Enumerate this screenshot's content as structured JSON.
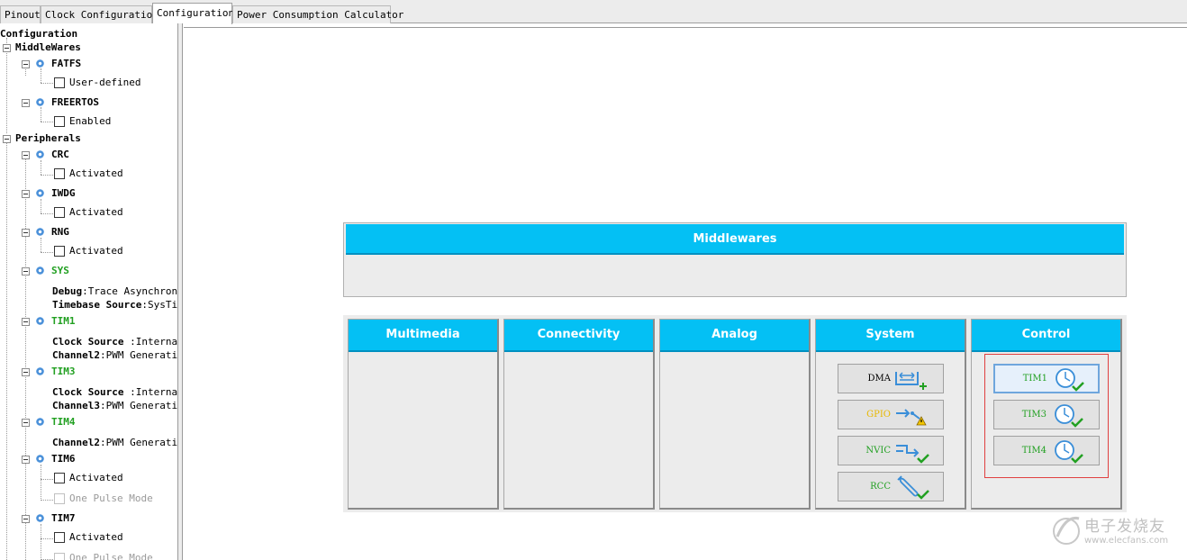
{
  "tabs": [
    "Pinout",
    "Clock Configuration",
    "Configuration",
    "Power Consumption Calculator"
  ],
  "tree": {
    "root": "Configuration",
    "middlewares_label": "MiddleWares",
    "fatfs": {
      "label": "FATFS",
      "option": "User-defined"
    },
    "freertos": {
      "label": "FREERTOS",
      "option": "Enabled"
    },
    "peripherals_label": "Peripherals",
    "crc": {
      "label": "CRC",
      "option": "Activated"
    },
    "iwdg": {
      "label": "IWDG",
      "option": "Activated"
    },
    "rng": {
      "label": "RNG",
      "option": "Activated"
    },
    "sys": {
      "label": "SYS",
      "debug_key": "Debug",
      "debug_val": ":Trace Asynchrono",
      "timebase_key": "Timebase Source",
      "timebase_val": ":SysTi"
    },
    "tim1": {
      "label": "TIM1",
      "clock_key": "Clock Source",
      "clock_val": " :Interna",
      "ch_key": "Channel2",
      "ch_val": ":PWM Generatio"
    },
    "tim3": {
      "label": "TIM3",
      "clock_key": "Clock Source",
      "clock_val": " :Interna",
      "ch_key": "Channel3",
      "ch_val": ":PWM Generatio"
    },
    "tim4": {
      "label": "TIM4",
      "ch_key": "Channel2",
      "ch_val": ":PWM Generatio"
    },
    "tim6": {
      "label": "TIM6",
      "option": "Activated",
      "option2": "One Pulse Mode"
    },
    "tim7": {
      "label": "TIM7",
      "option": "Activated",
      "option2": "One Pulse Mode"
    }
  },
  "main": {
    "middlewares_title": "Middlewares",
    "categories": [
      "Multimedia",
      "Connectivity",
      "Analog",
      "System",
      "Control"
    ],
    "system_buttons": [
      {
        "label": "DMA",
        "icon": "dma-icon"
      },
      {
        "label": "GPIO",
        "icon": "gpio-icon"
      },
      {
        "label": "NVIC",
        "icon": "nvic-icon"
      },
      {
        "label": "RCC",
        "icon": "rcc-icon"
      }
    ],
    "control_buttons": [
      {
        "label": "TIM1",
        "icon": "timer-icon"
      },
      {
        "label": "TIM3",
        "icon": "timer-icon"
      },
      {
        "label": "TIM4",
        "icon": "timer-icon"
      }
    ]
  },
  "watermark": {
    "text": "电子发烧友",
    "url_text": "www.elecfans.com"
  },
  "colors": {
    "header_blue": "#04c0f4",
    "ok_green": "#22a022",
    "warn_yellow": "#e8b800",
    "selection_red": "#e04040"
  }
}
